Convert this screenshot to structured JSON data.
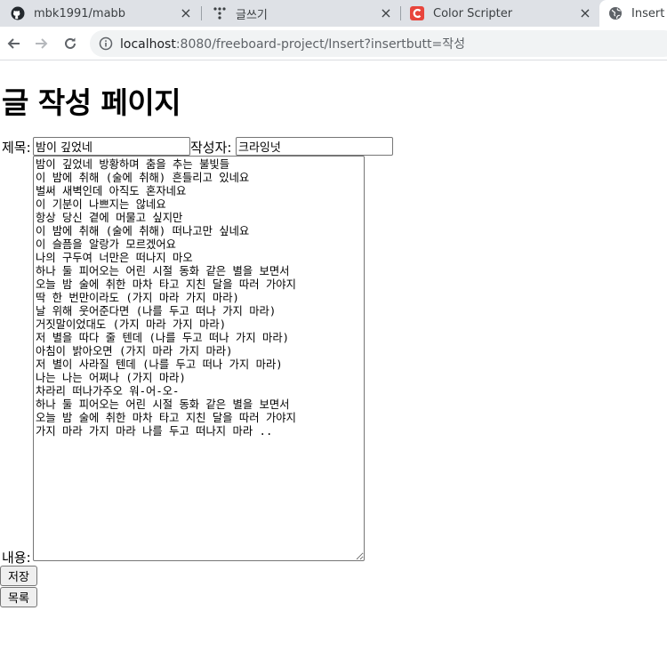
{
  "browser": {
    "tabs": [
      {
        "title": "mbk1991/mabb",
        "icon": "github-icon"
      },
      {
        "title": "글쓰기",
        "icon": "dots-icon"
      },
      {
        "title": "Color Scripter",
        "icon": "color-scripter-icon"
      },
      {
        "title": "Insert ti",
        "icon": "globe-icon"
      }
    ],
    "url_host": "localhost",
    "url_rest": ":8080/freeboard-project/Insert?insertbutt=작성"
  },
  "page": {
    "heading": "글 작성 페이지",
    "title_label": "제목:",
    "title_value": "밤이 깊었네",
    "writer_label": "작성자:",
    "writer_value": "크라잉넛",
    "content_label": "내용:",
    "content_value": "밤이 깊었네 방황하며 춤을 추는 불빛들\n이 밤에 취해 (술에 취해) 흔들리고 있네요\n벌써 새벽인데 아직도 혼자네요\n이 기분이 나쁘지는 않네요\n항상 당신 곁에 머물고 싶지만\n이 밤에 취해 (술에 취해) 떠나고만 싶네요\n이 슬픔을 알랑가 모르겠어요\n나의 구두여 너만은 떠나지 마오\n하나 둘 피어오는 어린 시절 동화 같은 별을 보면서\n오늘 밤 술에 취한 마차 타고 지친 달을 따러 가야지\n딱 한 번만이라도 (가지 마라 가지 마라)\n날 위해 웃어준다면 (나를 두고 떠나 가지 마라)\n거짓말이었대도 (가지 마라 가지 마라)\n저 별을 따다 줄 텐데 (나를 두고 떠나 가지 마라)\n아침이 밝아오면 (가지 마라 가지 마라)\n저 별이 사라질 텐데 (나를 두고 떠나 가지 마라)\n나는 나는 어쩌나 (가지 마라)\n차라리 떠나가주오 워-어-오-\n하나 둘 피어오는 어린 시절 동화 같은 별을 보면서\n오늘 밤 술에 취한 마차 타고 지친 달을 따러 가야지\n가지 마라 가지 마라 나를 두고 떠나지 마라 ..",
    "save_label": "저장",
    "list_label": "목록"
  }
}
